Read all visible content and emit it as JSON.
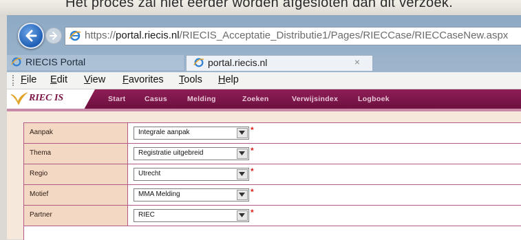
{
  "caption": {
    "text": "Het proces zal niet eerder worden afgesloten dan dit verzoek."
  },
  "browser": {
    "url_prefix": "https://",
    "url_host": "portal.riecis.nl",
    "url_path": "/RIECIS_Acceptatie_Distributie1/Pages/RIECCase/RIECCaseNew.aspx",
    "tabs": [
      {
        "label": "RIECIS Portal"
      },
      {
        "label": "portal.riecis.nl",
        "close": "×"
      }
    ],
    "menu": [
      "File",
      "Edit",
      "View",
      "Favorites",
      "Tools",
      "Help"
    ]
  },
  "app": {
    "logo_text": "RIEC IS",
    "nav": [
      "Start",
      "Casus",
      "Melding",
      "Zoeken",
      "Verwijsindex",
      "Logboek"
    ]
  },
  "form": {
    "required_mark": "*",
    "rows": [
      {
        "label": "Aanpak",
        "value": "Integrale aanpak"
      },
      {
        "label": "Thema",
        "value": "Registratie uitgebreid"
      },
      {
        "label": "Regio",
        "value": "Utrecht"
      },
      {
        "label": "Motief",
        "value": "MMA Melding"
      },
      {
        "label": "Partner",
        "value": "RIEC"
      }
    ]
  },
  "colors": {
    "brand": "#7a1244",
    "required": "#e01f1f",
    "label_bg": "#f3d9c3"
  }
}
